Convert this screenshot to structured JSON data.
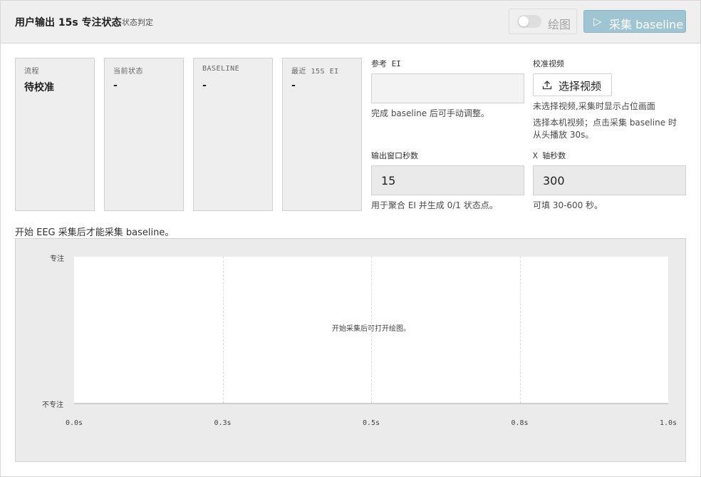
{
  "header": {
    "title": "用户输出 15s 专注状态",
    "subtitle": "状态判定",
    "plot_toggle_label": "绘图",
    "collect_button_label": "采集 baseline"
  },
  "stats": [
    {
      "label": "流程",
      "value": "待校准"
    },
    {
      "label": "当前状态",
      "value": "-"
    },
    {
      "label": "BASELINE",
      "value": "-"
    },
    {
      "label": "最近 15S EI",
      "value": "-"
    }
  ],
  "reference_ei": {
    "label": "参考 EI",
    "value": "",
    "hint": "完成 baseline 后可手动调整。"
  },
  "calibration_video": {
    "label": "校准视频",
    "button_label": "选择视频",
    "status": "未选择视频,采集时显示占位画面",
    "hint_line1": "选择本机视频；点击采集 baseline 时",
    "hint_line2": "从头播放 30s。"
  },
  "output_window": {
    "label": "输出窗口秒数",
    "value": "15",
    "hint": "用于聚合 EI 并生成 0/1 状态点。"
  },
  "x_axis_seconds": {
    "label": "X 轴秒数",
    "value": "300",
    "hint": "可填 30-600 秒。"
  },
  "notice": "开始 EEG 采集后才能采集 baseline。",
  "chart_data": {
    "type": "line",
    "series": [],
    "y_categories": [
      "不专注",
      "专注"
    ],
    "x_ticks": [
      "0.0s",
      "0.3s",
      "0.5s",
      "0.8s",
      "1.0s"
    ],
    "xlim": [
      0,
      1
    ],
    "grid": true,
    "empty_message": "开始采集后可打开绘图。"
  },
  "colors": {
    "accent_button": "#9fc5d2",
    "header_bg": "#efefef"
  }
}
